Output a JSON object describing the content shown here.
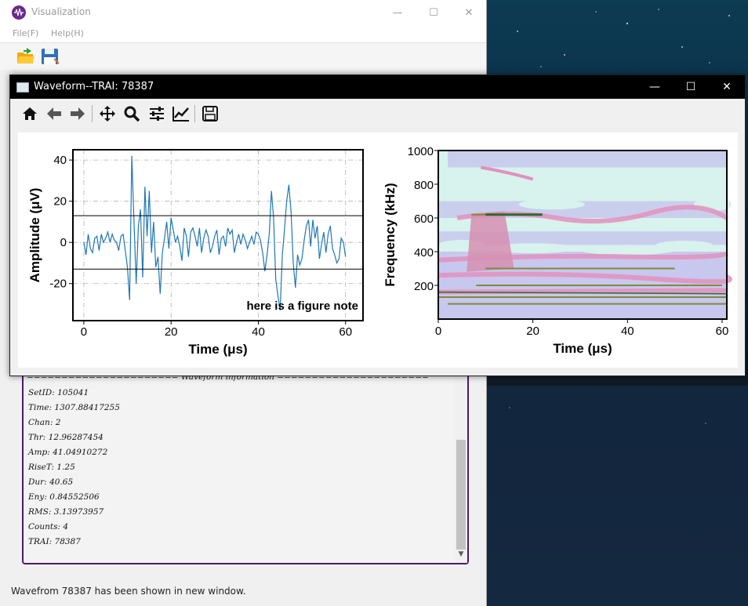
{
  "main_window": {
    "title": "Visualization",
    "menu": [
      "File(F)",
      "Help(H)"
    ],
    "toolbar_icons": [
      "open-folder-icon",
      "save-icon"
    ]
  },
  "wave_window": {
    "title": "Waveform--TRAI: 78387",
    "toolbar": [
      "home-icon",
      "back-icon",
      "forward-icon",
      "pan-icon",
      "zoom-icon",
      "configure-subplots-icon",
      "edit-axis-icon",
      "save-figure-icon"
    ]
  },
  "info": {
    "header": "====================== Waveform information ======================",
    "lines": [
      "SetID: 105041",
      "Time: 1307.88417255",
      "Chan: 2",
      "Thr: 12.96287454",
      "Amp: 41.04910272",
      "RiseT: 1.25",
      "Dur: 40.65",
      "Eny: 0.84552506",
      "RMS: 3.13973957",
      "Counts: 4",
      "TRAI: 78387"
    ]
  },
  "status": "Wavefrom 78387 has been shown in new window.",
  "chart_data": [
    {
      "type": "line",
      "xlabel": "Time (μs)",
      "ylabel": "Amplitude (μV)",
      "xlim": [
        -2.5,
        64
      ],
      "ylim": [
        -38,
        45
      ],
      "xticks": [
        "0",
        "20",
        "40",
        "60"
      ],
      "yticks": [
        "40",
        "20",
        "0",
        "-20"
      ],
      "grid": "on",
      "annotation": "here is a figure note",
      "threshold": 12.96,
      "x": [
        0,
        0.5,
        1,
        1.5,
        2,
        2.5,
        3,
        3.5,
        4,
        4.5,
        5,
        5.5,
        6,
        6.5,
        7,
        7.5,
        8,
        8.5,
        9,
        9.5,
        10,
        10.5,
        11,
        11.5,
        12,
        12.5,
        13,
        13.5,
        14,
        14.5,
        15,
        15.5,
        16,
        16.5,
        17,
        17.5,
        18,
        18.5,
        19,
        19.5,
        20,
        20.5,
        21,
        21.5,
        22,
        22.5,
        23,
        23.5,
        24,
        24.5,
        25,
        25.5,
        26,
        26.5,
        27,
        27.5,
        28,
        28.5,
        29,
        29.5,
        30,
        30.5,
        31,
        31.5,
        32,
        32.5,
        33,
        33.5,
        34,
        34.5,
        35,
        35.5,
        36,
        36.5,
        37,
        37.5,
        38,
        38.5,
        39,
        39.5,
        40,
        40.5,
        41,
        41.5,
        42,
        42.5,
        43,
        43.5,
        44,
        44.5,
        45,
        45.5,
        46,
        46.5,
        47,
        47.5,
        48,
        48.5,
        49,
        49.5,
        50,
        50.5,
        51,
        51.5,
        52,
        52.5,
        53,
        53.5,
        54,
        54.5,
        55,
        55.5,
        56,
        56.5,
        57,
        57.5,
        58,
        58.5,
        59,
        59.5,
        60,
        60.5,
        61
      ],
      "values": [
        0,
        -6,
        4,
        -3,
        -5,
        2,
        3,
        -4,
        4,
        0,
        2,
        5,
        0,
        4,
        1,
        0,
        -4,
        3,
        4,
        -4,
        -12,
        -28,
        42,
        10,
        -20,
        8,
        16,
        -17,
        27,
        3,
        25,
        -5,
        10,
        -12,
        -7,
        -25,
        -5,
        2,
        10,
        -3,
        12,
        6,
        0,
        3,
        -2,
        -9,
        7,
        3,
        -7,
        5,
        7,
        3,
        -2,
        7,
        -5,
        2,
        6,
        3,
        -5,
        -2,
        3,
        6,
        -6,
        2,
        3,
        -2,
        7,
        4,
        6,
        -5,
        0,
        4,
        -1,
        4,
        1,
        -3,
        0,
        3,
        -1,
        5,
        4,
        1,
        -5,
        -14,
        -6,
        4,
        25,
        12,
        -18,
        -26,
        -33,
        -6,
        6,
        20,
        28,
        15,
        -10,
        -22,
        -6,
        -11,
        -8,
        1,
        8,
        11,
        -2,
        11,
        2,
        8,
        -8,
        -1,
        5,
        -5,
        4,
        8,
        -3,
        -6,
        -10,
        -8,
        2,
        0,
        -7
      ]
    },
    {
      "type": "heatmap",
      "xlabel": "Time (μs)",
      "ylabel": "Frequency (kHz)",
      "xlim": [
        0,
        61
      ],
      "ylim": [
        0,
        1000
      ],
      "xticks": [
        "0",
        "20",
        "40",
        "60"
      ],
      "yticks": [
        "1000",
        "800",
        "600",
        "400",
        "200"
      ],
      "colors": [
        "#d8f2ee",
        "#c6c2ec",
        "#e390bd",
        "#d68fb0",
        "#7e8a3a",
        "#2f6a2a"
      ]
    }
  ]
}
